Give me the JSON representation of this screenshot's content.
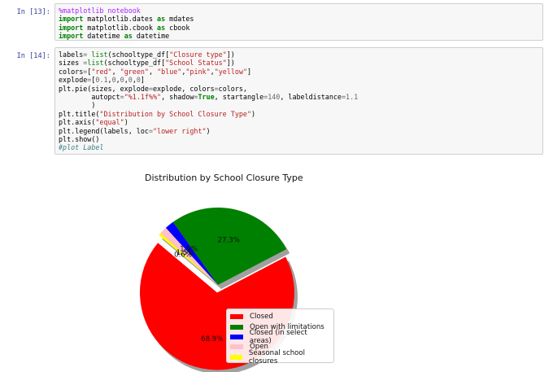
{
  "cells": [
    {
      "prompt": "In [13]:",
      "lines": [
        [
          [
            "mg",
            "%matplotlib notebook"
          ]
        ],
        [
          [
            "kw",
            "import"
          ],
          [
            "t",
            " matplotlib.dates "
          ],
          [
            "kw",
            "as"
          ],
          [
            "t",
            " mdates"
          ]
        ],
        [
          [
            "kw",
            "import"
          ],
          [
            "t",
            " matplotlib.cbook "
          ],
          [
            "kw",
            "as"
          ],
          [
            "t",
            " cbook"
          ]
        ],
        [
          [
            "kw",
            "import"
          ],
          [
            "t",
            " datetime "
          ],
          [
            "kw",
            "as"
          ],
          [
            "t",
            " datetime"
          ]
        ]
      ]
    },
    {
      "prompt": "In [14]:",
      "lines": [
        [
          [
            "t",
            "labels"
          ],
          [
            "op",
            "="
          ],
          [
            "t",
            " "
          ],
          [
            "nm",
            "list"
          ],
          [
            "t",
            "(schooltype_df["
          ],
          [
            "st",
            "\"Closure type\""
          ],
          [
            "t",
            "])"
          ]
        ],
        [
          [
            "t",
            "sizes "
          ],
          [
            "op",
            "="
          ],
          [
            "nm",
            "list"
          ],
          [
            "t",
            "(schooltype_df["
          ],
          [
            "st",
            "\"School Status\""
          ],
          [
            "t",
            "])"
          ]
        ],
        [
          [
            "t",
            "colors"
          ],
          [
            "op",
            "="
          ],
          [
            "t",
            "["
          ],
          [
            "st",
            "\"red\""
          ],
          [
            "t",
            ", "
          ],
          [
            "st",
            "\"green\""
          ],
          [
            "t",
            ", "
          ],
          [
            "st",
            "\"blue\""
          ],
          [
            "t",
            ","
          ],
          [
            "st",
            "\"pink\""
          ],
          [
            "t",
            ","
          ],
          [
            "st",
            "\"yellow\""
          ],
          [
            "t",
            "]"
          ]
        ],
        [
          [
            "t",
            "explode"
          ],
          [
            "op",
            "="
          ],
          [
            "t",
            "["
          ],
          [
            "num",
            "0.1"
          ],
          [
            "t",
            ","
          ],
          [
            "num",
            "0"
          ],
          [
            "t",
            ","
          ],
          [
            "num",
            "0"
          ],
          [
            "t",
            ","
          ],
          [
            "num",
            "0"
          ],
          [
            "t",
            ","
          ],
          [
            "num",
            "0"
          ],
          [
            "t",
            "]"
          ]
        ],
        [
          [
            "t",
            "plt.pie(sizes, explode"
          ],
          [
            "op",
            "="
          ],
          [
            "t",
            "explode, colors"
          ],
          [
            "op",
            "="
          ],
          [
            "t",
            "colors,"
          ]
        ],
        [
          [
            "t",
            "        autopct"
          ],
          [
            "op",
            "="
          ],
          [
            "st",
            "\"%1.1f%%\""
          ],
          [
            "t",
            ", shadow"
          ],
          [
            "op",
            "="
          ],
          [
            "kw",
            "True"
          ],
          [
            "t",
            ", startangle"
          ],
          [
            "op",
            "="
          ],
          [
            "num",
            "140"
          ],
          [
            "t",
            ", labeldistance"
          ],
          [
            "op",
            "="
          ],
          [
            "num",
            "1.1"
          ]
        ],
        [
          [
            "t",
            "        )"
          ]
        ],
        [
          [
            "t",
            "plt.title("
          ],
          [
            "st",
            "\"Distribution by School Closure Type\""
          ],
          [
            "t",
            ")"
          ]
        ],
        [
          [
            "t",
            "plt.axis("
          ],
          [
            "st",
            "\"equal\""
          ],
          [
            "t",
            ")"
          ]
        ],
        [
          [
            "t",
            "plt.legend(labels, loc"
          ],
          [
            "op",
            "="
          ],
          [
            "st",
            "\"lower right\""
          ],
          [
            "t",
            ")"
          ]
        ],
        [
          [
            "t",
            "plt.show()"
          ]
        ],
        [
          [
            "cm",
            "#plot Label"
          ]
        ]
      ]
    }
  ],
  "chart_data": {
    "type": "pie",
    "title": "Distribution by School Closure Type",
    "labels": [
      "Closed",
      "Open with limitations",
      "Closed (in select areas)",
      "Open",
      "Seasonal school closures"
    ],
    "values": [
      68.9,
      27.3,
      1.9,
      1.5,
      0.6
    ],
    "value_labels": [
      "68.9%",
      "27.3%",
      "1.9%",
      "1.5%",
      "0.6%"
    ],
    "colors": [
      "#ff0000",
      "#008000",
      "#0000ff",
      "#ffc0cb",
      "#ffff00"
    ],
    "explode": [
      0.1,
      0,
      0,
      0,
      0
    ],
    "startangle": 140,
    "shadow": true,
    "legend_loc": "lower right"
  }
}
